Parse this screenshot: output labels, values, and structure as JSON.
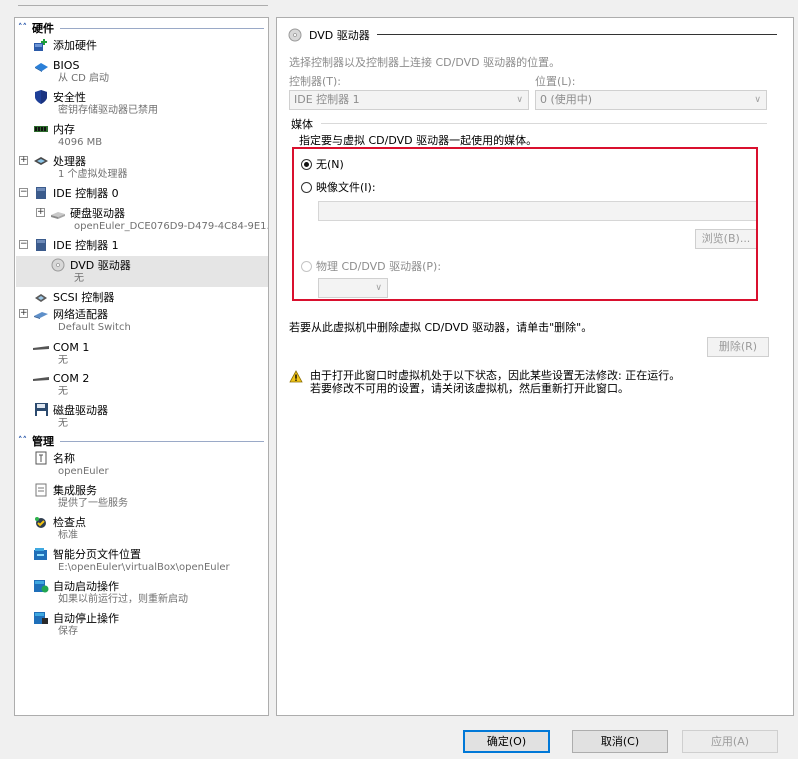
{
  "sidebar": {
    "hardware_header": "硬件",
    "management_header": "管理",
    "items": [
      {
        "title": "添加硬件",
        "sub": ""
      },
      {
        "title": "BIOS",
        "sub": "从 CD 启动"
      },
      {
        "title": "安全性",
        "sub": "密钥存储驱动器已禁用"
      },
      {
        "title": "内存",
        "sub": "4096 MB"
      },
      {
        "title": "处理器",
        "sub": "1 个虚拟处理器"
      },
      {
        "title": "IDE 控制器 0",
        "sub": ""
      },
      {
        "title": "硬盘驱动器",
        "sub": "openEuler_DCE076D9-D479-4C84-9E1..."
      },
      {
        "title": "IDE 控制器 1",
        "sub": ""
      },
      {
        "title": "DVD 驱动器",
        "sub": "无"
      },
      {
        "title": "SCSI 控制器",
        "sub": ""
      },
      {
        "title": "网络适配器",
        "sub": "Default Switch"
      },
      {
        "title": "COM 1",
        "sub": "无"
      },
      {
        "title": "COM 2",
        "sub": "无"
      },
      {
        "title": "磁盘驱动器",
        "sub": "无"
      }
    ],
    "mgmt_items": [
      {
        "title": "名称",
        "sub": "openEuler"
      },
      {
        "title": "集成服务",
        "sub": "提供了一些服务"
      },
      {
        "title": "检查点",
        "sub": "标准"
      },
      {
        "title": "智能分页文件位置",
        "sub": "E:\\openEuler\\virtualBox\\openEuler"
      },
      {
        "title": "自动启动操作",
        "sub": "如果以前运行过，则重新启动"
      },
      {
        "title": "自动停止操作",
        "sub": "保存"
      }
    ]
  },
  "panel": {
    "header": "DVD 驱动器",
    "description": "选择控制器以及控制器上连接 CD/DVD 驱动器的位置。",
    "controller_label": "控制器(T):",
    "controller_value": "IDE 控制器 1",
    "location_label": "位置(L):",
    "location_value": "0 (使用中)",
    "media_label": "媒体",
    "media_desc": "指定要与虚拟 CD/DVD 驱动器一起使用的媒体。",
    "opt_none": "无(N)",
    "opt_image": "映像文件(I):",
    "browse": "浏览(B)...",
    "opt_physical": "物理 CD/DVD 驱动器(P):",
    "remove_desc": "若要从此虚拟机中删除虚拟 CD/DVD 驱动器，请单击\"删除\"。",
    "remove_btn": "删除(R)",
    "warning_line1": "由于打开此窗口时虚拟机处于以下状态，因此某些设置无法修改: 正在运行。",
    "warning_line2": "若要修改不可用的设置，请关闭该虚拟机，然后重新打开此窗口。"
  },
  "footer": {
    "ok": "确定(O)",
    "cancel": "取消(C)",
    "apply": "应用(A)"
  },
  "colors": {
    "highlight": "#d9102e",
    "accent": "#0078d7"
  }
}
